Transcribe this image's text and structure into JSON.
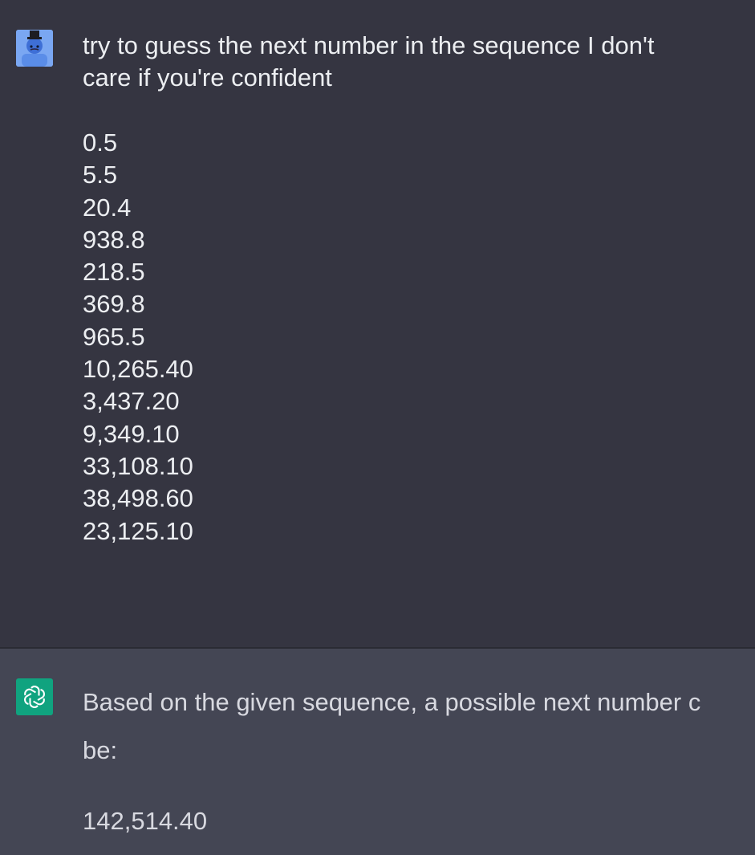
{
  "user": {
    "avatar": "user-avatar-icon",
    "message": "try to guess the next number in the sequence I don't\ncare if you're confident",
    "sequence": [
      "0.5",
      "5.5",
      "20.4",
      "938.8",
      "218.5",
      "369.8",
      "965.5",
      "10,265.40",
      "3,437.20",
      "9,349.10",
      "33,108.10",
      "38,498.60",
      "23,125.10"
    ]
  },
  "assistant": {
    "avatar": "openai-logo-icon",
    "line1": "Based on the given sequence, a possible next number c",
    "line2": "be:",
    "answer": "142,514.40"
  },
  "colors": {
    "user_background": "#353541",
    "assistant_background": "#444654",
    "avatar_user": "#7aa7f2",
    "avatar_assistant": "#10a37f"
  }
}
